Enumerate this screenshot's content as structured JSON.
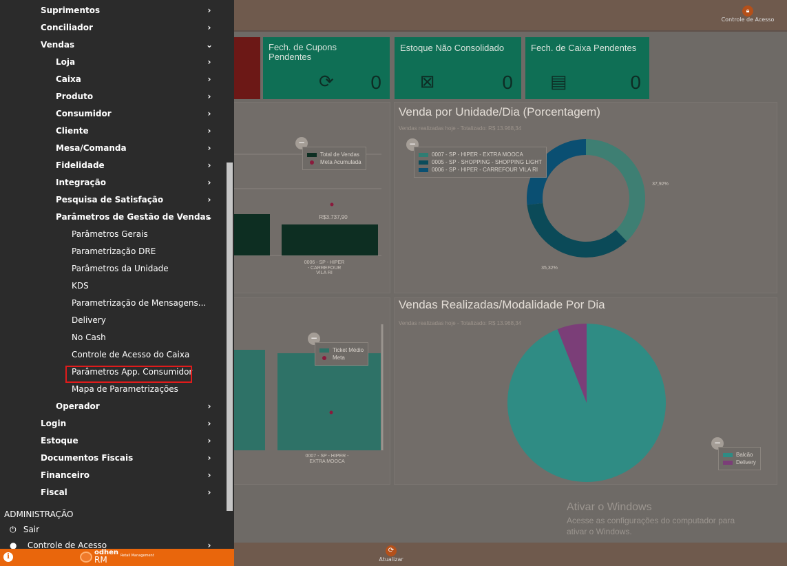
{
  "topbar": {
    "controle_acesso_label": "Controle de Acesso"
  },
  "tiles": [
    {
      "title": "Fech. de Cupons Pendentes",
      "value": "0"
    },
    {
      "title": "Estoque Não Consolidado",
      "value": "0"
    },
    {
      "title": "Fech. de Caixa Pendentes",
      "value": "0"
    }
  ],
  "panel_left_top": {
    "legend": [
      "Total de Vendas",
      "Meta Acumulada"
    ],
    "bar_label": "R$3.737,90",
    "category_label": "0006 - SP - HIPER - CARREFOUR VILA RI"
  },
  "panel_right_top": {
    "title": "Venda por Unidade/Dia (Porcentagem)",
    "subtitle": "Vendas realizadas hoje - Totalizado: R$ 13.968,34",
    "legend": [
      "0007 - SP - HIPER - EXTRA MOOCA",
      "0005 - SP - SHOPPING - SHOPPING LIGHT",
      "0006 - SP - HIPER - CARREFOUR VILA RI"
    ],
    "pct_right": "37,92%",
    "pct_bottom": "35,32%"
  },
  "panel_left_bottom": {
    "legend": [
      "Ticket Médio",
      "Meta"
    ],
    "category_label": "0007 - SP - HIPER - EXTRA MOOCA"
  },
  "panel_right_bottom": {
    "title": "Vendas Realizadas/Modalidade Por Dia",
    "subtitle": "Vendas realizadas hoje - Totalizado: R$ 13.968,34",
    "legend": [
      "Balcão",
      "Delivery"
    ]
  },
  "windows_activation": {
    "title": "Ativar o Windows",
    "line1": "Acesse as configurações do computador para",
    "line2": "ativar o Windows."
  },
  "bottombar": {
    "atualizar_label": "Atualizar"
  },
  "chart_data": [
    {
      "type": "pie",
      "title": "Venda por Unidade/Dia (Porcentagem)",
      "categories": [
        "0007 - SP - HIPER - EXTRA MOOCA",
        "0005 - SP - SHOPPING - SHOPPING LIGHT",
        "0006 - SP - HIPER - CARREFOUR VILA RI"
      ],
      "values": [
        37.92,
        35.32,
        26.76
      ]
    },
    {
      "type": "pie",
      "title": "Vendas Realizadas/Modalidade Por Dia",
      "categories": [
        "Balcão",
        "Delivery"
      ],
      "values": [
        94,
        6
      ]
    }
  ],
  "sidebar": {
    "items": [
      {
        "label": "Suprimentos",
        "level": 1,
        "chevron": "›"
      },
      {
        "label": "Conciliador",
        "level": 1,
        "chevron": "›"
      },
      {
        "label": "Vendas",
        "level": 1,
        "chevron": "⌄"
      },
      {
        "label": "Loja",
        "level": 2,
        "chevron": "›"
      },
      {
        "label": "Caixa",
        "level": 2,
        "chevron": "›"
      },
      {
        "label": "Produto",
        "level": 2,
        "chevron": "›"
      },
      {
        "label": "Consumidor",
        "level": 2,
        "chevron": "›"
      },
      {
        "label": "Cliente",
        "level": 2,
        "chevron": "›"
      },
      {
        "label": "Mesa/Comanda",
        "level": 2,
        "chevron": "›"
      },
      {
        "label": "Fidelidade",
        "level": 2,
        "chevron": "›"
      },
      {
        "label": "Integração",
        "level": 2,
        "chevron": "›"
      },
      {
        "label": "Pesquisa de Satisfação",
        "level": 2,
        "chevron": "›"
      },
      {
        "label": "Parâmetros de Gestão de Vendas",
        "level": 2,
        "chevron": "⌄"
      },
      {
        "label": "Parâmetros Gerais",
        "level": 3,
        "chevron": ""
      },
      {
        "label": "Parametrização DRE",
        "level": 3,
        "chevron": ""
      },
      {
        "label": "Parâmetros da Unidade",
        "level": 3,
        "chevron": ""
      },
      {
        "label": "KDS",
        "level": 3,
        "chevron": ""
      },
      {
        "label": "Parametrização de Mensagens...",
        "level": 3,
        "chevron": ""
      },
      {
        "label": "Delivery",
        "level": 3,
        "chevron": ""
      },
      {
        "label": "No Cash",
        "level": 3,
        "chevron": ""
      },
      {
        "label": "Controle de Acesso do Caixa",
        "level": 3,
        "chevron": ""
      },
      {
        "label": "Parâmetros App. Consumidor",
        "level": 3,
        "chevron": ""
      },
      {
        "label": "Mapa de Parametrizações",
        "level": 3,
        "chevron": ""
      },
      {
        "label": "Operador",
        "level": 2,
        "chevron": "›"
      },
      {
        "label": "Login",
        "level": 1,
        "chevron": "›"
      },
      {
        "label": "Estoque",
        "level": 1,
        "chevron": "›"
      },
      {
        "label": "Documentos Fiscais",
        "level": 1,
        "chevron": "›"
      },
      {
        "label": "Financeiro",
        "level": 1,
        "chevron": "›"
      },
      {
        "label": "Fiscal",
        "level": 1,
        "chevron": "›"
      }
    ],
    "section_label": "ADMINISTRAÇÃO",
    "sair_label": "Sair",
    "controle_label": "Controle de Acesso",
    "footer": {
      "brand_top": "odhen",
      "brand_bottom": "RM",
      "brand_sub": "Retail Management",
      "info_glyph": "i"
    }
  }
}
